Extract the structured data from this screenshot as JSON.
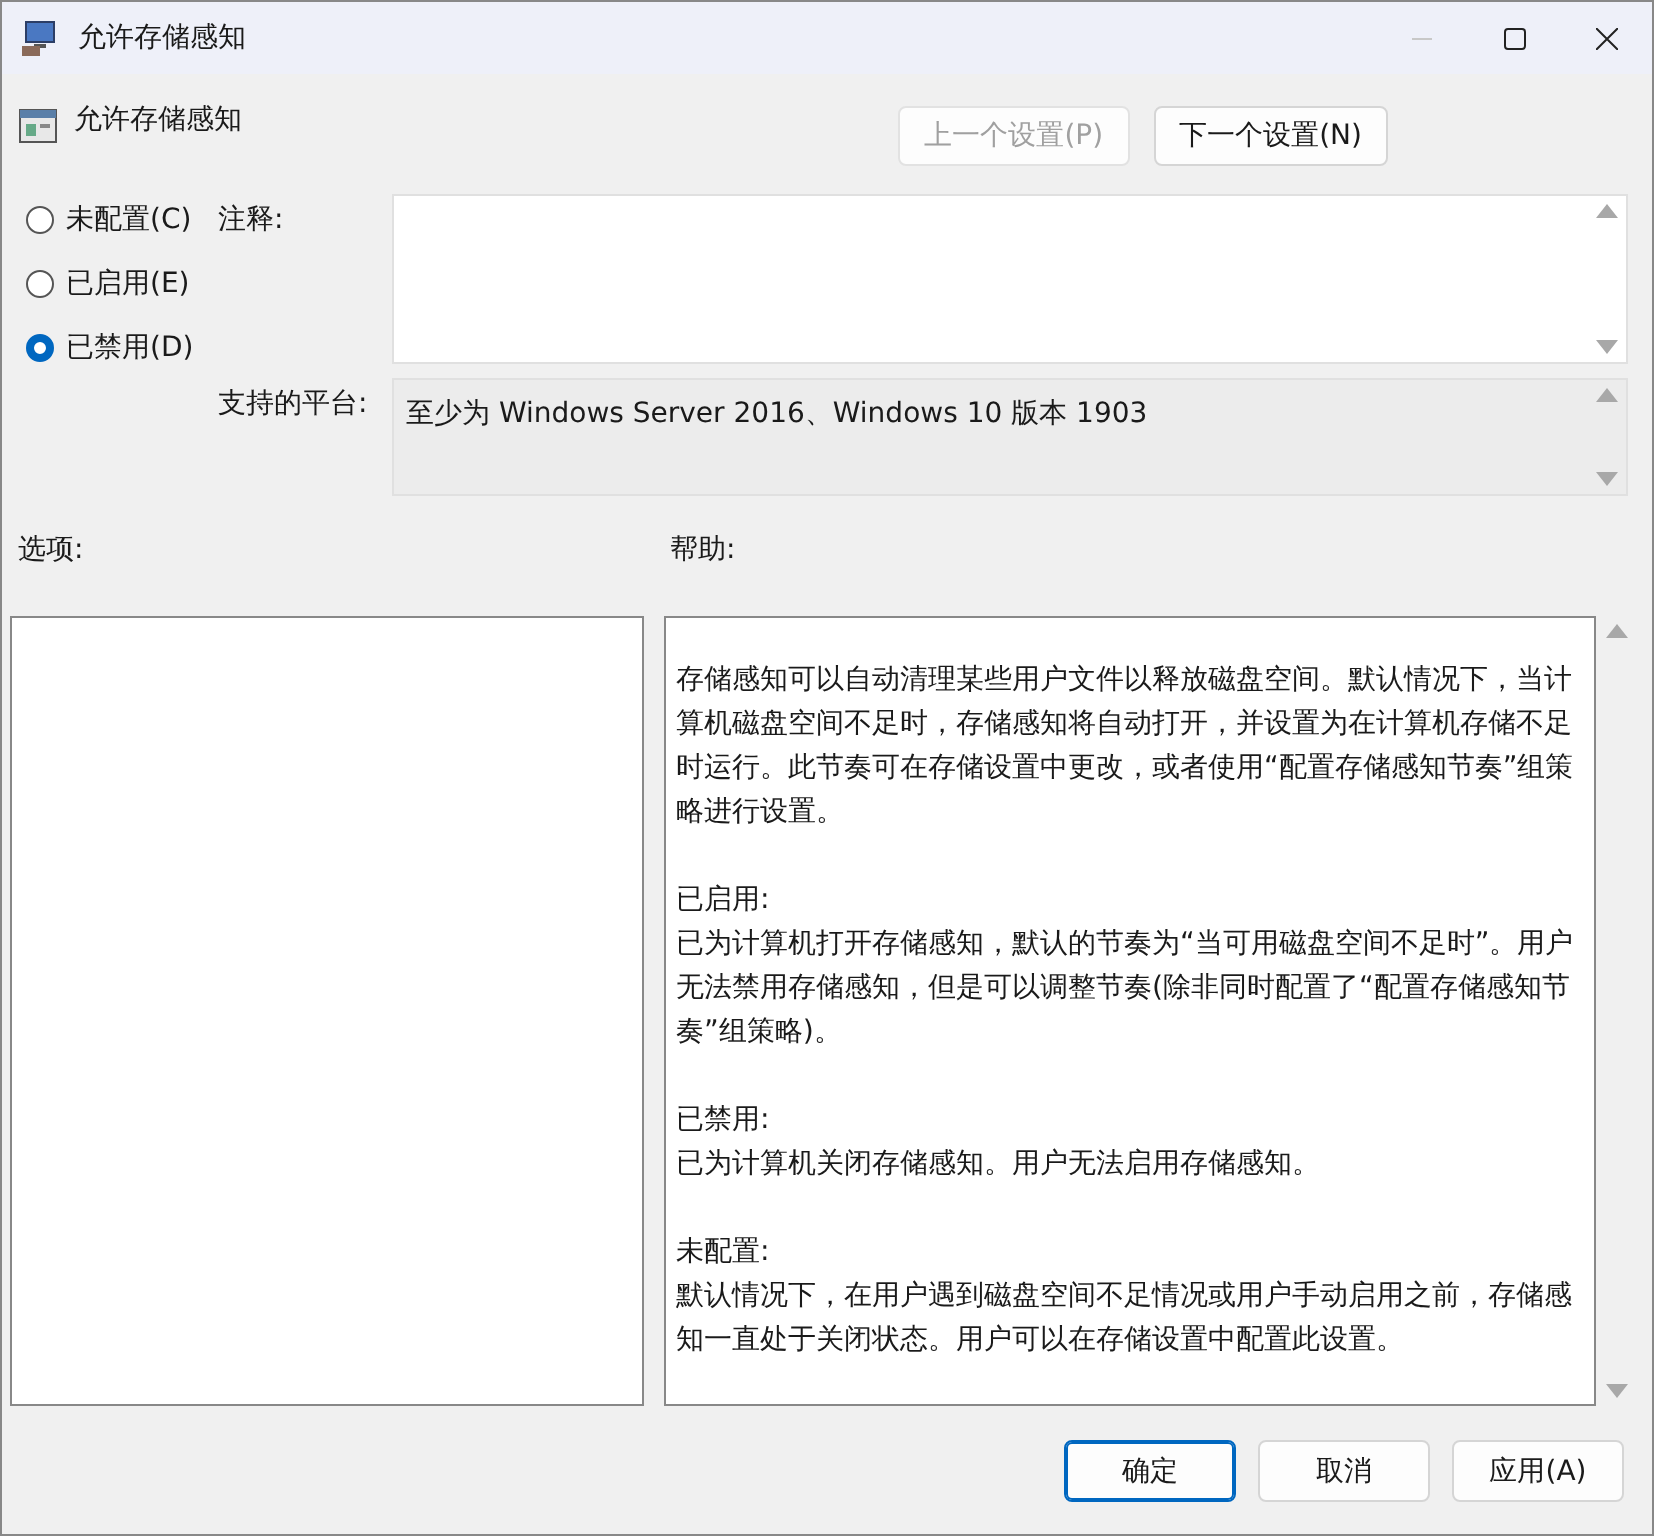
{
  "window": {
    "title": "允许存储感知"
  },
  "header": {
    "title": "允许存储感知",
    "buttons": [
      {
        "label": "上一个设置(P)",
        "disabled": true
      },
      {
        "label": "下一个设置(N)",
        "disabled": false
      }
    ]
  },
  "states": [
    {
      "label": "未配置(C)",
      "selected": false
    },
    {
      "label": "已启用(E)",
      "selected": false
    },
    {
      "label": "已禁用(D)",
      "selected": true
    }
  ],
  "comment": {
    "label": "注释:"
  },
  "platform": {
    "label": "支持的平台:",
    "value": "至少为 Windows Server 2016、Windows 10 版本 1903"
  },
  "options": {
    "label": "选项:"
  },
  "help": {
    "label": "帮助:",
    "paragraphs": [
      "存储感知可以自动清理某些用户文件以释放磁盘空间。默认情况下，当计算机磁盘空间不足时，存储感知将自动打开，并设置为在计算机存储不足时运行。此节奏可在存储设置中更改，或者使用“配置存储感知节奏”组策略进行设置。",
      "已启用:\n已为计算机打开存储感知，默认的节奏为“当可用磁盘空间不足时”。用户无法禁用存储感知，但是可以调整节奏(除非同时配置了“配置存储感知节奏”组策略)。",
      "已禁用:\n已为计算机关闭存储感知。用户无法启用存储感知。",
      "未配置:\n默认情况下，在用户遇到磁盘空间不足情况或用户手动启用之前，存储感知一直处于关闭状态。用户可以在存储设置中配置此设置。"
    ]
  },
  "footer": {
    "buttons": [
      {
        "label": "确定",
        "selected": true
      },
      {
        "label": "取消",
        "selected": false
      },
      {
        "label": "应用(A)",
        "selected": false
      }
    ]
  }
}
